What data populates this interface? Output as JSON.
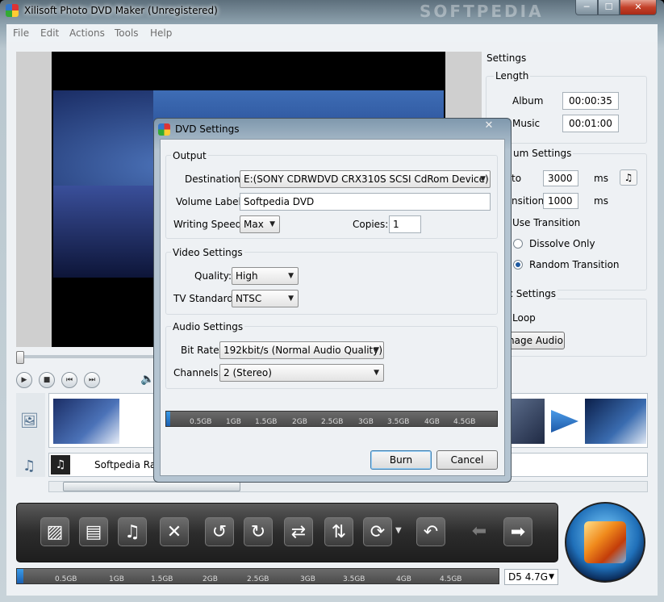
{
  "window": {
    "title": "Xilisoft Photo DVD Maker (Unregistered)",
    "watermark": "SOFTPEDIA",
    "min": "─",
    "max": "☐",
    "close": "✕"
  },
  "menu": [
    "File",
    "Edit",
    "Actions",
    "Tools",
    "Help"
  ],
  "settings": {
    "title": "Settings",
    "length_title": "Length",
    "album_label": "Album",
    "album_value": "00:00:35",
    "music_label": "Music",
    "music_value": "00:01:00",
    "album_settings_title": "um Settings",
    "duration_label": "to",
    "duration_value": "3000",
    "duration_unit": "ms",
    "transition_label": "nsition",
    "transition_value": "1000",
    "transition_unit": "ms",
    "use_transition": "Use Transition",
    "dissolve_only": "Dissolve Only",
    "random_transition": "Random Transition",
    "music_settings_title": "ic Settings",
    "loop_label": "Loop",
    "manage_audio": "nage Audio"
  },
  "timeline": {
    "audio_track_label": "Softpedia Rad"
  },
  "capacity": {
    "ticks": [
      "0.5GB",
      "1GB",
      "1.5GB",
      "2GB",
      "2.5GB",
      "3GB",
      "3.5GB",
      "4GB",
      "4.5GB"
    ],
    "disc": "D5 4.7G"
  },
  "dialog": {
    "title": "DVD Settings",
    "close": "✕",
    "output_title": "Output",
    "destination_label": "Destination:",
    "destination_value": "E:(SONY CDRWDVD CRX310S SCSI CdRom Device)",
    "volume_label": "Volume Label:",
    "volume_value": "Softpedia DVD",
    "writing_speed_label": "Writing Speed:",
    "writing_speed_value": "Max",
    "copies_label": "Copies:",
    "copies_value": "1",
    "video_title": "Video Settings",
    "quality_label": "Quality:",
    "quality_value": "High",
    "tv_label": "TV Standard:",
    "tv_value": "NTSC",
    "audio_title": "Audio Settings",
    "bitrate_label": "Bit Rate:",
    "bitrate_value": "192kbit/s (Normal Audio Quality)",
    "channels_label": "Channels:",
    "channels_value": "2 (Stereo)",
    "burn": "Burn",
    "cancel": "Cancel"
  }
}
